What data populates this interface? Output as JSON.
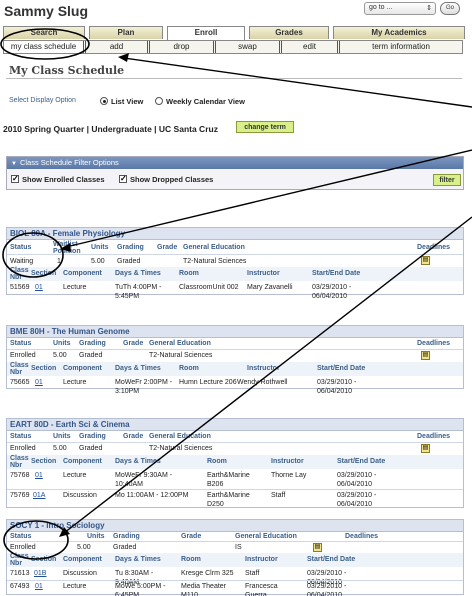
{
  "top": {
    "user_name": "Sammy Slug",
    "goto_value": "go to ...",
    "go_label": "Go"
  },
  "tabs": [
    "Search",
    "Plan",
    "Enroll",
    "Grades",
    "My Academics"
  ],
  "subnav": [
    "my class schedule",
    "add",
    "drop",
    "swap",
    "edit",
    "term information"
  ],
  "page_title": "My Class Schedule",
  "display": {
    "label": "Select Display Option",
    "list_view": "List View",
    "weekly_view": "Weekly Calendar View",
    "selected": "List View"
  },
  "term": {
    "text": "2010 Spring Quarter | Undergraduate | UC Santa Cruz",
    "change_label": "change term"
  },
  "filter": {
    "title": "Class Schedule Filter Options",
    "enrolled_label": "Show Enrolled Classes",
    "dropped_label": "Show Dropped Classes",
    "filter_label": "filter"
  },
  "headers": {
    "status": "Status",
    "waitlist": "Waitlist Position",
    "units": "Units",
    "grading": "Grading",
    "grade": "Grade",
    "gen_ed": "General Education",
    "deadlines": "Deadlines",
    "class_nbr": "Class Nbr",
    "section": "Section",
    "component": "Component",
    "days_times": "Days & Times",
    "room": "Room",
    "instructor": "Instructor",
    "dates": "Start/End Date"
  },
  "courses": [
    {
      "title": "BIOL 80A - Female Physiology",
      "status": "Waiting",
      "waitlist": "1",
      "units": "5.00",
      "grading": "Graded",
      "grade": "",
      "gen_ed": "T2-Natural Sciences",
      "sections": [
        {
          "nbr": "51569",
          "section": "01",
          "component": "Lecture",
          "days": "TuTh 4:00PM - 5:45PM",
          "room": "ClassroomUnit 002",
          "instructor": "Mary Zavanelli",
          "dates": "03/29/2010 - 06/04/2010"
        }
      ]
    },
    {
      "title": "BME 80H - The Human Genome",
      "status": "Enrolled",
      "units": "5.00",
      "grading": "Graded",
      "grade": "",
      "gen_ed": "T2-Natural Sciences",
      "sections": [
        {
          "nbr": "75665",
          "section": "01",
          "component": "Lecture",
          "days": "MoWeFr 2:00PM - 3:10PM",
          "room": "Humn Lecture 206",
          "instructor": "Wendy Rothwell",
          "dates": "03/29/2010 - 06/04/2010"
        }
      ]
    },
    {
      "title": "EART 80D - Earth Sci & Cinema",
      "status": "Enrolled",
      "units": "5.00",
      "grading": "Graded",
      "grade": "",
      "gen_ed": "T2-Natural Sciences",
      "sections": [
        {
          "nbr": "75768",
          "section": "01",
          "component": "Lecture",
          "days": "MoWeFr 9:30AM - 10:40AM",
          "room": "Earth&Marine B206",
          "instructor": "Thorne Lay",
          "dates": "03/29/2010 - 06/04/2010"
        },
        {
          "nbr": "75769",
          "section": "01A",
          "component": "Discussion",
          "days": "Mo 11:00AM - 12:00PM",
          "room": "Earth&Marine D250",
          "instructor": "Staff",
          "dates": "03/29/2010 - 06/04/2010"
        }
      ]
    },
    {
      "title": "SOCY 1 - Intro Sociology",
      "status": "Enrolled",
      "units": "5.00",
      "grading": "Graded",
      "grade": "",
      "gen_ed": "IS",
      "sections": [
        {
          "nbr": "71613",
          "section": "01B",
          "component": "Discussion",
          "days": "Tu 8:30AM - 9:40AM",
          "room": "Kresge Clrm 325",
          "instructor": "Staff",
          "dates": "03/29/2010 - 06/04/2010"
        },
        {
          "nbr": "67493",
          "section": "01",
          "component": "Lecture",
          "days": "MoWe 5:00PM - 6:45PM",
          "room": "Media Theater M110",
          "instructor": "Francesca Guerra",
          "dates": "03/29/2010 - 06/04/2010"
        }
      ]
    }
  ]
}
